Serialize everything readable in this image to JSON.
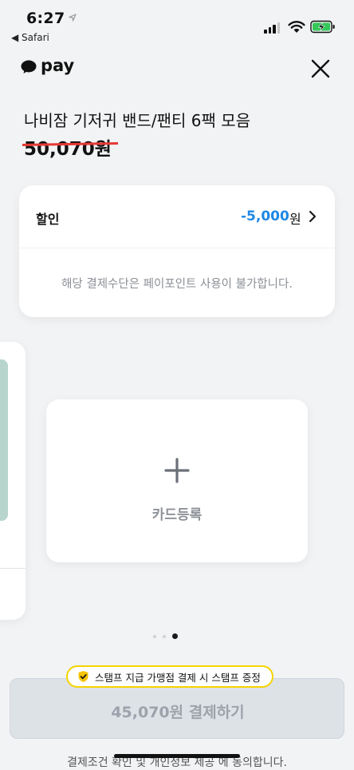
{
  "status_bar": {
    "time": "6:27",
    "back_app": "◀ Safari",
    "icons": [
      "location-arrow-icon",
      "signal-icon",
      "wifi-icon",
      "battery-charging-icon"
    ]
  },
  "header": {
    "brand": "pay",
    "logo_icon": "chat-bubble-icon",
    "close_icon": "close-icon"
  },
  "product": {
    "title": "나비잠 기저귀 밴드/팬티 6팩 모음",
    "original_price": "50,070원"
  },
  "discount": {
    "label": "할인",
    "amount": "-5,000",
    "unit": "원",
    "note": "해당 결제수단은 페이포인트 사용이 불가합니다."
  },
  "add_card": {
    "label": "카드등록"
  },
  "carousel": {
    "page_count": 3,
    "active_index": 2
  },
  "stamp_badge": {
    "text": "스탬프 지급 가맹점 결제 시 스탬프 증정"
  },
  "pay_button": {
    "label": "45,070원 결제하기"
  },
  "terms": {
    "text": "결제조건 확인 및 개인정보 제공 에 동의합니다."
  },
  "colors": {
    "accent_blue": "#1e88e5",
    "strike_red": "#e53935",
    "stamp_yellow": "#f5d400",
    "background": "#f2f3f5"
  }
}
